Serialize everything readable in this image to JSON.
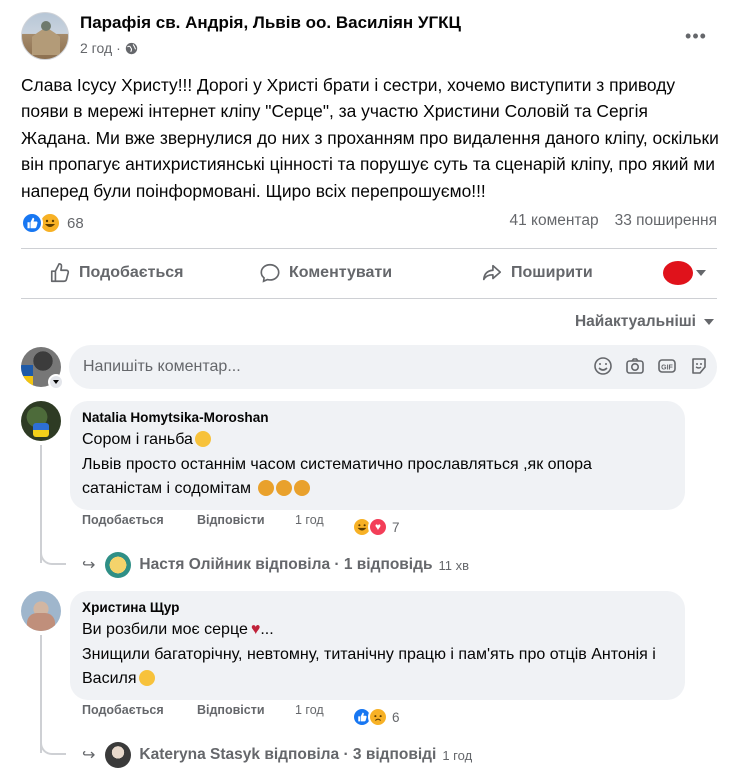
{
  "post": {
    "page_name": "Парафія св. Андрія, Львів оо. Василіян УГКЦ",
    "time": "2 год",
    "dot": "·",
    "text": "Слава Ісусу Христу!!! Дорогі у Христі брати і сестри, хочемо виступити з приводу появи в  мережі інтернет кліпу \"Серце\", за участю Христини Соловій та Сергія Жадана. Ми вже звернулися до них з проханням про видалення даного кліпу, оскільки він пропагує антихристиянські цінності та порушує суть та сценарій кліпу, про який ми наперед були поінформовані. Щиро всіх перепрошуємо!!!",
    "reaction_count": "68",
    "comments_count": "41 коментар",
    "shares_count": "33 поширення"
  },
  "actions": {
    "like": "Подобається",
    "comment": "Коментувати",
    "share": "Поширити"
  },
  "sort": {
    "label": "Найактуальніші"
  },
  "composer": {
    "placeholder": "Напишіть коментар..."
  },
  "comments": [
    {
      "author": "Natalia Homytsika-Moroshan",
      "line1": "Сором і ганьба",
      "line2": "Львів просто останнім часом систематично прославляться ,як опора сатаністам і содомітам",
      "like": "Подобається",
      "reply": "Відповісти",
      "time": "1 год",
      "reactions": "7",
      "reply_summary": "Настя Олійник відповіла · 1 відповідь",
      "reply_time": "11 хв"
    },
    {
      "author": "Христина Щур",
      "line1": "Ви розбили моє серце",
      "line2": "Знищили багаторічну, невтомну, титанічну працю і пам'ять про отців Антонія і Василя",
      "like": "Подобається",
      "reply": "Відповісти",
      "time": "1 год",
      "reactions": "6",
      "reply_summary": "Kateryna Stasyk відповіла · 3 відповіді",
      "reply_time": "1 год"
    }
  ],
  "colors": {
    "accent": "#1877f2",
    "secondary_text": "#65676b",
    "bubble": "#f0f2f5"
  }
}
